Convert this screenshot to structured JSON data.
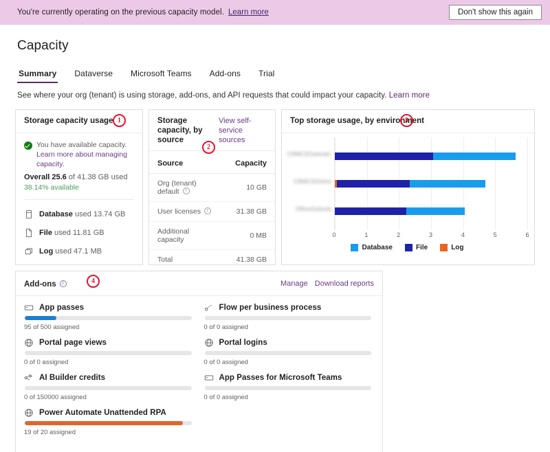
{
  "banner": {
    "text": "You're currently operating on the previous capacity model.",
    "link": "Learn more",
    "dismiss": "Don't show this again",
    "bg_color": "#edc9e8"
  },
  "page": {
    "title": "Capacity",
    "subtitle": "See where your org (tenant) is using storage, add-ons, and API requests that could impact your capacity.",
    "subtitle_link": "Learn more",
    "accent_color": "#5b2a67"
  },
  "tabs": [
    {
      "label": "Summary",
      "active": true
    },
    {
      "label": "Dataverse",
      "active": false
    },
    {
      "label": "Microsoft Teams",
      "active": false
    },
    {
      "label": "Add-ons",
      "active": false
    },
    {
      "label": "Trial",
      "active": false
    }
  ],
  "annotations": [
    {
      "number": "1",
      "target": "storage-capacity-usage-card"
    },
    {
      "number": "2",
      "target": "storage-capacity-by-source-card"
    },
    {
      "number": "3",
      "target": "top-storage-usage-by-environment-card"
    },
    {
      "number": "4",
      "target": "add-ons-card"
    }
  ],
  "storage_usage_card": {
    "title": "Storage capacity usage",
    "status_text": "You have available capacity.",
    "status_link": "Learn more about managing capacity.",
    "overall_prefix": "Overall",
    "overall_used": "25.6",
    "overall_of": "of 41.38 GB used",
    "available": "38.14% available",
    "available_color": "#4a9c5d",
    "items": [
      {
        "icon": "database-icon",
        "name": "Database",
        "value": "used 13.74 GB"
      },
      {
        "icon": "file-icon",
        "name": "File",
        "value": "used 11.81 GB"
      },
      {
        "icon": "log-icon",
        "name": "Log",
        "value": "used 47.1 MB"
      }
    ]
  },
  "source_card": {
    "title": "Storage capacity, by source",
    "link": "View self-service sources",
    "columns": [
      "Source",
      "Capacity"
    ],
    "rows": [
      {
        "source": "Org (tenant) default",
        "info": true,
        "capacity": "10 GB"
      },
      {
        "source": "User licenses",
        "info": true,
        "capacity": "31.38 GB"
      },
      {
        "source": "Additional capacity",
        "info": false,
        "capacity": "0 MB"
      },
      {
        "source": "Total",
        "info": false,
        "capacity": "41.38 GB"
      }
    ]
  },
  "chart_card": {
    "title": "Top storage usage, by environment"
  },
  "chart_data": {
    "type": "bar",
    "orientation": "horizontal",
    "stacked": true,
    "title": "Top storage usage, by environment",
    "xlabel": "",
    "ylabel": "",
    "xlim": [
      0,
      6
    ],
    "xticks": [
      0,
      1,
      2,
      3,
      4,
      5,
      6
    ],
    "grid": true,
    "legend_position": "bottom",
    "categories": [
      "CRMC3Outlook1",
      "CRMC3Online",
      "OfficeOutlook"
    ],
    "categories_redacted": true,
    "series": [
      {
        "name": "Database",
        "color": "#1a9ced",
        "values": [
          2.58,
          2.36,
          1.82
        ]
      },
      {
        "name": "File",
        "color": "#1f22a8",
        "values": [
          3.06,
          2.28,
          2.22
        ]
      },
      {
        "name": "Log",
        "color": "#ec6322",
        "values": [
          0.0,
          0.06,
          0.0
        ]
      }
    ],
    "totals": [
      5.64,
      4.7,
      4.04
    ]
  },
  "addons_card": {
    "title": "Add-ons",
    "links": [
      "Manage",
      "Download reports"
    ],
    "items": [
      {
        "icon": "app-passes-icon",
        "name": "App passes",
        "assigned": 95,
        "total": 500,
        "sub": "95 of 500 assigned",
        "color": "#1a7fd4",
        "percent": 19
      },
      {
        "icon": "flow-icon",
        "name": "Flow per business process",
        "assigned": 0,
        "total": 0,
        "sub": "0 of 0 assigned",
        "color": "#1a7fd4",
        "percent": 0
      },
      {
        "icon": "portal-icon",
        "name": "Portal page views",
        "assigned": 0,
        "total": 0,
        "sub": "0 of 0 assigned",
        "color": "#1a7fd4",
        "percent": 0
      },
      {
        "icon": "portal-icon",
        "name": "Portal logins",
        "assigned": 0,
        "total": 0,
        "sub": "0 of 0 assigned",
        "color": "#1a7fd4",
        "percent": 0
      },
      {
        "icon": "ai-builder-icon",
        "name": "AI Builder credits",
        "assigned": 0,
        "total": 150000,
        "sub": "0 of 150000 assigned",
        "color": "#1a7fd4",
        "percent": 0
      },
      {
        "icon": "app-passes-icon",
        "name": "App Passes for Microsoft Teams",
        "assigned": 0,
        "total": 0,
        "sub": "0 of 0 assigned",
        "color": "#1a7fd4",
        "percent": 0
      },
      {
        "icon": "portal-icon",
        "name": "Power Automate Unattended RPA",
        "assigned": 19,
        "total": 20,
        "sub": "19 of 20 assigned",
        "color": "#e2662a",
        "percent": 95
      }
    ]
  }
}
